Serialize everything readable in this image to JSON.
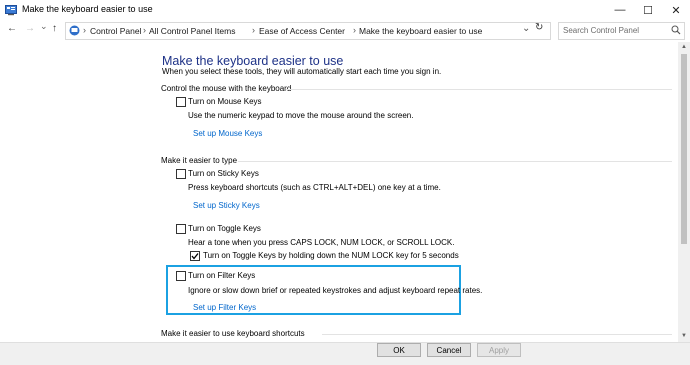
{
  "window": {
    "title": "Make the keyboard easier to use",
    "minimize": "—",
    "maximize": "☐",
    "close": "✕"
  },
  "nav": {
    "back": "←",
    "forward": "→",
    "recent": "⌄",
    "up": "↑",
    "refresh": "↻",
    "breadcrumbs": [
      "Control Panel",
      "All Control Panel Items",
      "Ease of Access Center",
      "Make the keyboard easier to use"
    ],
    "separator": "›",
    "dropdown": "⌄",
    "search_placeholder": "Search Control Panel"
  },
  "page": {
    "heading": "Make the keyboard easier to use",
    "subtext": "When you select these tools, they will automatically start each time you sign in."
  },
  "sections": {
    "mouse": {
      "title": "Control the mouse with the keyboard",
      "checkbox": "Turn on Mouse Keys",
      "description": "Use the numeric keypad to move the mouse around the screen.",
      "link": "Set up Mouse Keys"
    },
    "typing": {
      "title": "Make it easier to type",
      "sticky": {
        "checkbox": "Turn on Sticky Keys",
        "description": "Press keyboard shortcuts (such as CTRL+ALT+DEL) one key at a time.",
        "link": "Set up Sticky Keys"
      },
      "toggle": {
        "checkbox": "Turn on Toggle Keys",
        "description": "Hear a tone when you press CAPS LOCK, NUM LOCK, or SCROLL LOCK.",
        "sub_checkbox": "Turn on Toggle Keys by holding down the NUM LOCK key for 5 seconds",
        "sub_checked": true
      },
      "filter": {
        "checkbox": "Turn on Filter Keys",
        "description": "Ignore or slow down brief or repeated keystrokes and adjust keyboard repeat rates.",
        "link": "Set up Filter Keys"
      }
    },
    "shortcuts": {
      "title": "Make it easier to use keyboard shortcuts"
    }
  },
  "footer": {
    "ok": "OK",
    "cancel": "Cancel",
    "apply": "Apply"
  },
  "colors": {
    "heading": "#1e3287",
    "link": "#0066cc",
    "highlight_border": "#1ba1e2"
  },
  "icons": [
    "control-panel-icon",
    "search-icon",
    "refresh-icon",
    "back-arrow-icon",
    "forward-arrow-icon",
    "up-arrow-icon",
    "checkmark-icon"
  ]
}
